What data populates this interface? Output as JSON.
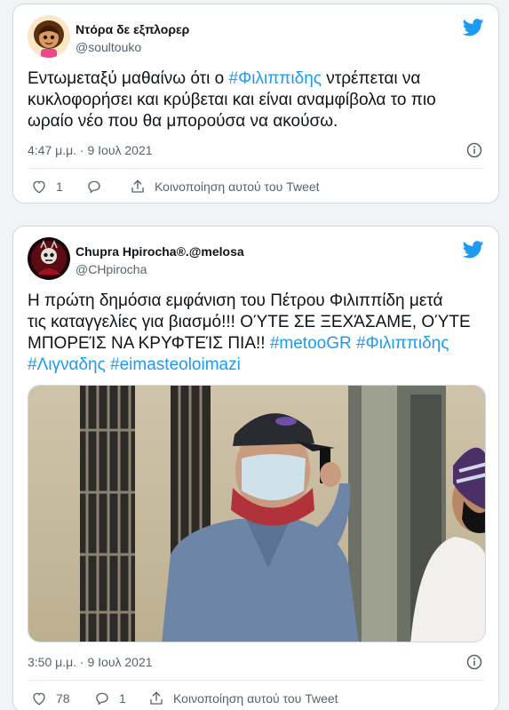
{
  "tweets": [
    {
      "display_name": "Ντόρα δε εξπλορερ",
      "handle": "@soultouko",
      "text_lines": [
        [
          {
            "t": "Εντωμεταξύ μαθαίνω  ότι ο "
          },
          {
            "t": "#Φιλιππιδης",
            "tag": true
          },
          {
            "t": " ντρέπεται να"
          }
        ],
        [
          {
            "t": "κυκλοφορήσει και κρύβεται και είναι αναμφίβολα το πιο"
          }
        ],
        [
          {
            "t": "ωραίο νέο που θα μπορούσα να ακούσω."
          }
        ]
      ],
      "timestamp": "4:47 μ.μ. · 9 Ιουλ 2021",
      "likes": "1",
      "replies": "",
      "share_label": "Κοινοποίηση αυτού του Tweet"
    },
    {
      "display_name": "Chupra Hpirocha",
      "display_name_suffix": "®.@melosa",
      "handle": "@CHpirocha",
      "text_lines": [
        [
          {
            "t": "Η πρώτη δημόσια εμφάνιση του Πέτρου Φιλιππίδη μετά"
          }
        ],
        [
          {
            "t": "τις καταγγελίες για βιασμό!!! ΟΎΤΕ ΣΕ ΞΕΧΆΣΑΜΕ, ΟΎΤΕ"
          }
        ],
        [
          {
            "t": "ΜΠΟΡΕΊΣ ΝΑ ΚΡΥΦΤΕΊΣ ΠΙΑ!! "
          },
          {
            "t": "#metooGR",
            "tag": true
          },
          {
            "t": " "
          },
          {
            "t": "#Φιλιππιδης",
            "tag": true
          }
        ],
        [
          {
            "t": "#Λιγναδης",
            "tag": true
          },
          {
            "t": " "
          },
          {
            "t": "#eimasteoloimazi",
            "tag": true
          }
        ]
      ],
      "timestamp": "3:50 μ.μ. · 9 Ιουλ 2021",
      "likes": "78",
      "replies": "1",
      "share_label": "Κοινοποίηση αυτού του Tweet"
    }
  ],
  "colors": {
    "twitter_blue": "#1d9bf0",
    "text": "#0f1419",
    "muted": "#536471",
    "border": "#cfd9de"
  },
  "icons": [
    "twitter-bird-icon",
    "info-icon",
    "heart-icon",
    "reply-icon",
    "share-icon"
  ]
}
